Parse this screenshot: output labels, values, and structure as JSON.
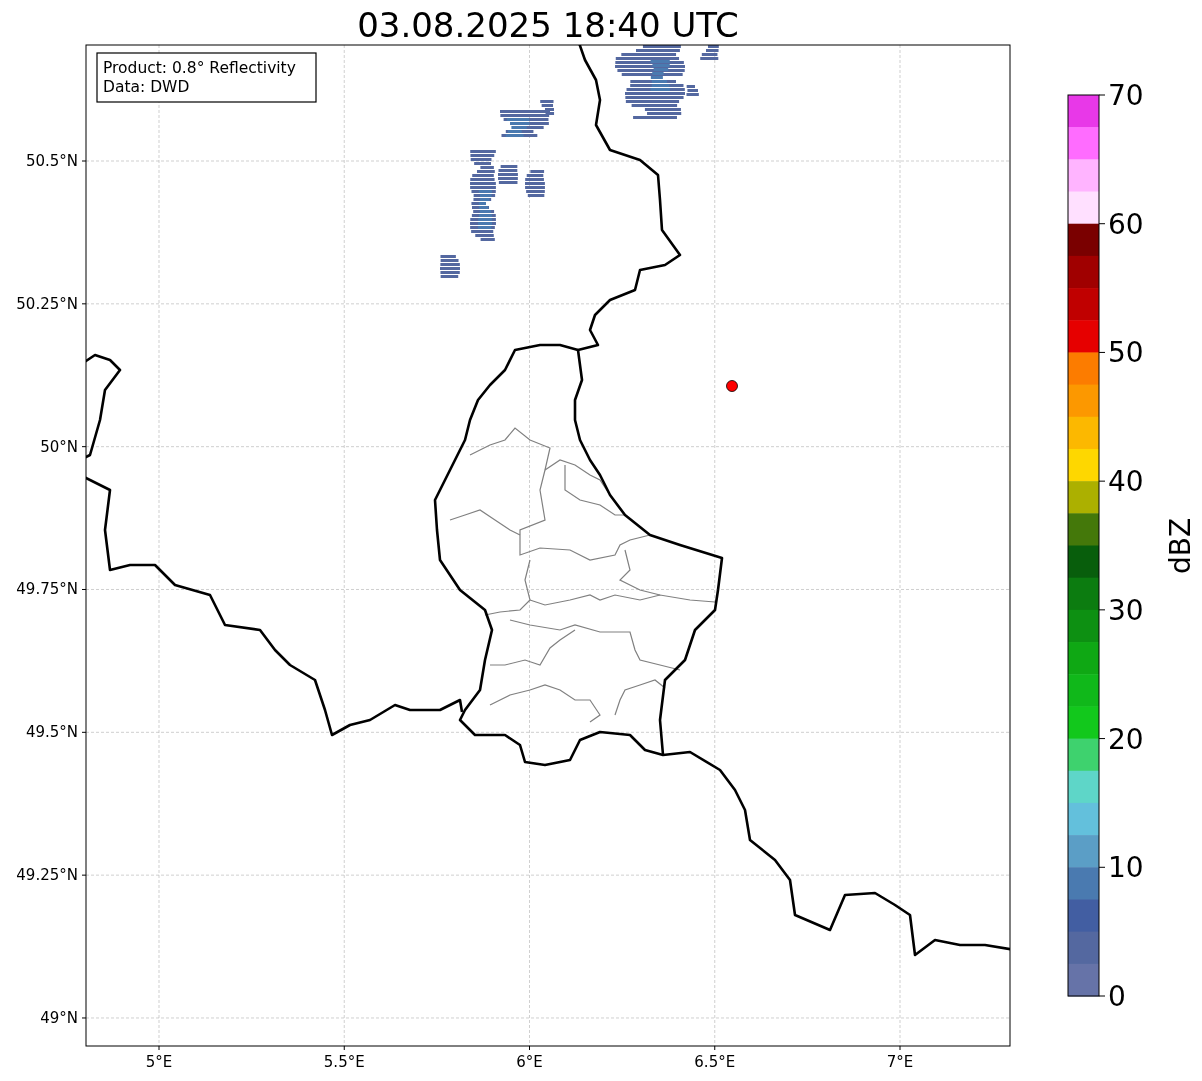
{
  "title": "03.08.2025 18:40 UTC",
  "info_box": {
    "lines": [
      "Product: 0.8° Reflectivity",
      "Data: DWD"
    ]
  },
  "map": {
    "lat_ticks": [
      "50.5°N",
      "50.25°N",
      "50°N",
      "49.75°N",
      "49.5°N",
      "49.25°N",
      "49°N"
    ],
    "lon_ticks": [
      "5°E",
      "5.5°E",
      "6°E",
      "6.5°E",
      "7°E"
    ]
  },
  "colorbar": {
    "label": "dBZ",
    "ticks": [
      "70",
      "60",
      "50",
      "40",
      "30",
      "20",
      "10",
      "0"
    ],
    "bins": [
      {
        "color": "#e838e8"
      },
      {
        "color": "#ff6cff"
      },
      {
        "color": "#ffb4ff"
      },
      {
        "color": "#ffe0ff"
      },
      {
        "color": "#7a0000"
      },
      {
        "color": "#a00000"
      },
      {
        "color": "#c00000"
      },
      {
        "color": "#e60000"
      },
      {
        "color": "#fc7c00"
      },
      {
        "color": "#fc9800"
      },
      {
        "color": "#fcb800"
      },
      {
        "color": "#fed700"
      },
      {
        "color": "#acb000"
      },
      {
        "color": "#44780a"
      },
      {
        "color": "#085e0c"
      },
      {
        "color": "#0c7c10"
      },
      {
        "color": "#0d9012"
      },
      {
        "color": "#0fa814"
      },
      {
        "color": "#10b81a"
      },
      {
        "color": "#12c81c"
      },
      {
        "color": "#3ed26e"
      },
      {
        "color": "#5ed6c8"
      },
      {
        "color": "#63c0dc"
      },
      {
        "color": "#5b9ec6"
      },
      {
        "color": "#4a7ab0"
      },
      {
        "color": "#425ea2"
      },
      {
        "color": "#5468a0"
      },
      {
        "color": "#6673a8"
      }
    ]
  }
}
